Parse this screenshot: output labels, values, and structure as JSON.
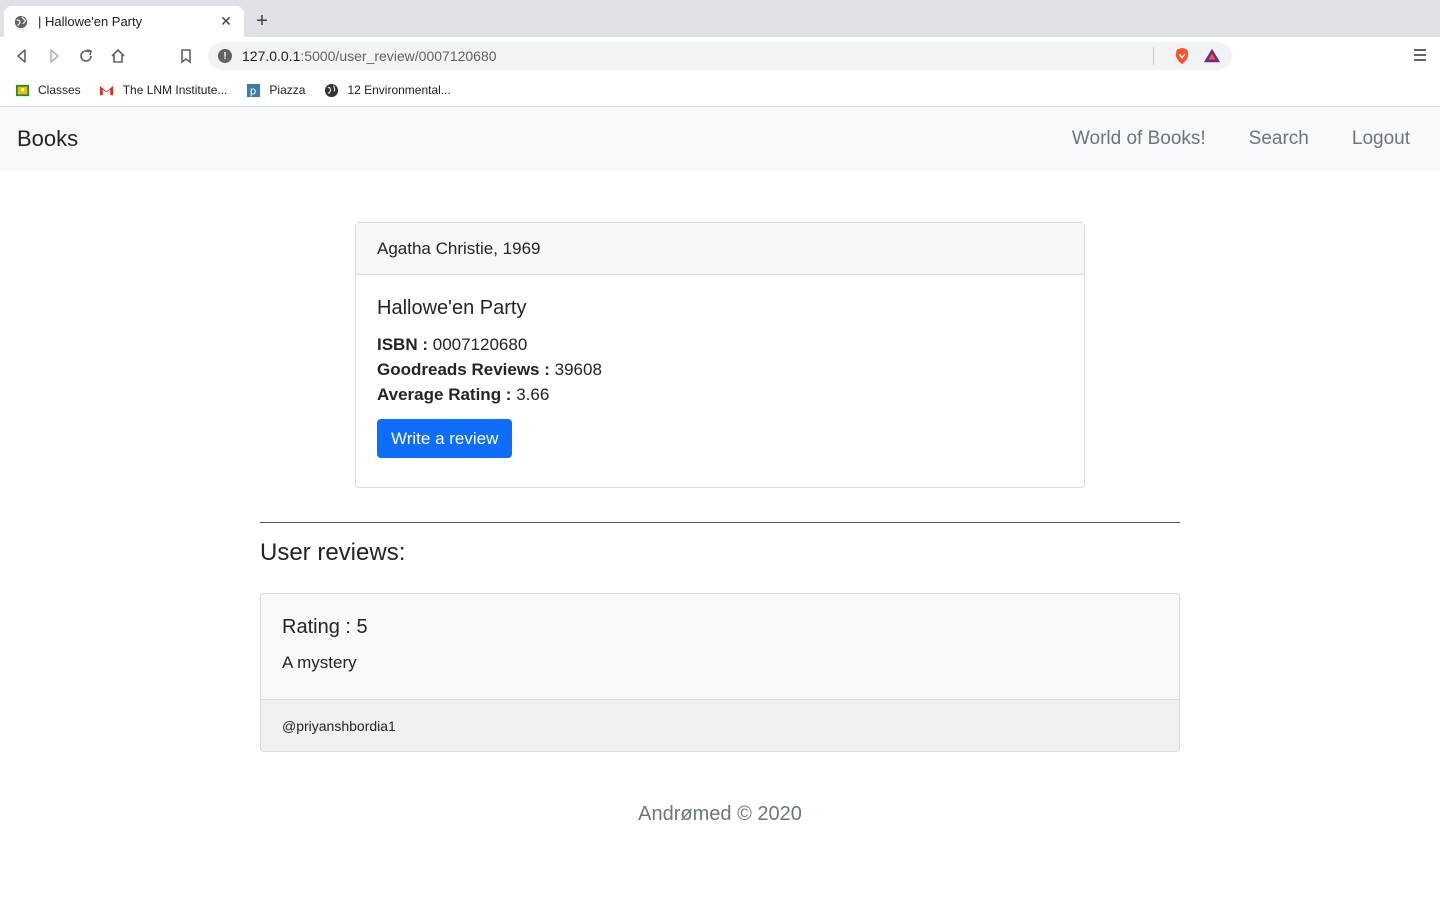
{
  "browser": {
    "tab_title": "| Hallowe'en Party",
    "tab_close": "✕",
    "new_tab": "+",
    "url_host": "127.0.0.1",
    "url_path": ":5000/user_review/0007120680",
    "bookmarks": [
      {
        "label": "Classes",
        "icon": "classroom-icon"
      },
      {
        "label": "The LNM Institute...",
        "icon": "gmail-icon"
      },
      {
        "label": "Piazza",
        "icon": "piazza-icon"
      },
      {
        "label": "12 Environmental...",
        "icon": "globe-icon"
      }
    ]
  },
  "navbar": {
    "brand": "Books",
    "links": [
      "World of Books!",
      "Search",
      "Logout"
    ]
  },
  "book": {
    "header": "Agatha Christie, 1969",
    "title": "Hallowe'en Party",
    "isbn_label": "ISBN :",
    "isbn": "0007120680",
    "reviews_label": "Goodreads Reviews :",
    "reviews_count": "39608",
    "rating_label": "Average Rating :",
    "rating": "3.66",
    "review_button": "Write a review"
  },
  "reviews": {
    "title": "User reviews:",
    "items": [
      {
        "rating": "Rating : 5",
        "text": "A mystery",
        "user": "@priyanshbordia1"
      }
    ]
  },
  "footer": "Andrømed © 2020",
  "colors": {
    "primary": "#0d6efd",
    "navbar_bg": "#f8f9fa",
    "muted": "#6c757d"
  }
}
